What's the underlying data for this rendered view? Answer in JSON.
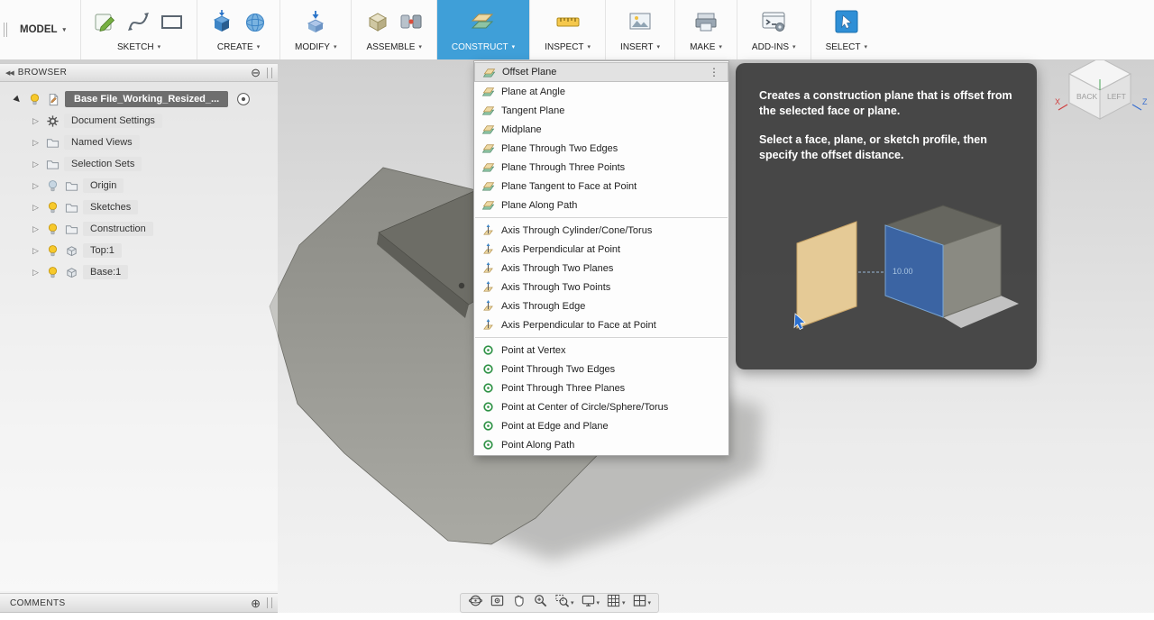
{
  "toolbar": {
    "model_label": "MODEL",
    "groups": [
      {
        "label": "SKETCH",
        "icons": [
          "sketch",
          "spline",
          "rectangle"
        ]
      },
      {
        "label": "CREATE",
        "icons": [
          "extrude",
          "sphere"
        ]
      },
      {
        "label": "MODIFY",
        "icons": [
          "press-pull"
        ]
      },
      {
        "label": "ASSEMBLE",
        "icons": [
          "new-component",
          "joint"
        ]
      },
      {
        "label": "CONSTRUCT",
        "icons": [
          "construction-plane"
        ],
        "active": true
      },
      {
        "label": "INSPECT",
        "icons": [
          "measure"
        ]
      },
      {
        "label": "INSERT",
        "icons": [
          "insert-image"
        ]
      },
      {
        "label": "MAKE",
        "icons": [
          "print-3d"
        ]
      },
      {
        "label": "ADD-INS",
        "icons": [
          "scripts-addins"
        ]
      },
      {
        "label": "SELECT",
        "icons": [
          "select"
        ]
      }
    ]
  },
  "browser": {
    "title": "BROWSER",
    "root_label": "Base File_Working_Resized_...",
    "items": [
      {
        "label": "Document Settings",
        "icon": "gear"
      },
      {
        "label": "Named Views",
        "icon": "folder"
      },
      {
        "label": "Selection Sets",
        "icon": "folder"
      },
      {
        "label": "Origin",
        "icon": "folder",
        "bulb": "off"
      },
      {
        "label": "Sketches",
        "icon": "folder",
        "bulb": "on"
      },
      {
        "label": "Construction",
        "icon": "folder",
        "bulb": "on"
      },
      {
        "label": "Top:1",
        "icon": "component",
        "bulb": "on"
      },
      {
        "label": "Base:1",
        "icon": "component",
        "bulb": "on"
      }
    ]
  },
  "construct_menu": {
    "items": [
      {
        "label": "Offset Plane",
        "icon": "offset-plane",
        "highlighted": true,
        "more": true
      },
      {
        "label": "Plane at Angle",
        "icon": "plane-at-angle"
      },
      {
        "label": "Tangent Plane",
        "icon": "tangent-plane"
      },
      {
        "label": "Midplane",
        "icon": "midplane"
      },
      {
        "label": "Plane Through Two Edges",
        "icon": "plane-two-edges"
      },
      {
        "label": "Plane Through Three Points",
        "icon": "plane-three-points"
      },
      {
        "label": "Plane Tangent to Face at Point",
        "icon": "plane-tangent-face"
      },
      {
        "label": "Plane Along Path",
        "icon": "plane-along-path",
        "divider_after": true
      },
      {
        "label": "Axis Through Cylinder/Cone/Torus",
        "icon": "axis-cylinder"
      },
      {
        "label": "Axis Perpendicular at Point",
        "icon": "axis-perpendicular-point"
      },
      {
        "label": "Axis Through Two Planes",
        "icon": "axis-two-planes"
      },
      {
        "label": "Axis Through Two Points",
        "icon": "axis-two-points"
      },
      {
        "label": "Axis Through Edge",
        "icon": "axis-edge"
      },
      {
        "label": "Axis Perpendicular to Face at Point",
        "icon": "axis-perp-face",
        "divider_after": true
      },
      {
        "label": "Point at Vertex",
        "icon": "point-vertex"
      },
      {
        "label": "Point Through Two Edges",
        "icon": "point-two-edges"
      },
      {
        "label": "Point Through Three Planes",
        "icon": "point-three-planes"
      },
      {
        "label": "Point at Center of Circle/Sphere/Torus",
        "icon": "point-center-circle"
      },
      {
        "label": "Point at Edge and Plane",
        "icon": "point-edge-plane"
      },
      {
        "label": "Point Along Path",
        "icon": "point-along-path"
      }
    ]
  },
  "tooltip": {
    "p1": "Creates a construction plane that is offset from the selected face or plane.",
    "p2": "Select a face, plane, or sketch profile, then specify the offset distance.",
    "dimension_label": "10.00"
  },
  "viewcube": {
    "faces": [
      "BACK",
      "LEFT"
    ],
    "axes": [
      "X",
      "Z"
    ]
  },
  "comments": {
    "title": "COMMENTS"
  },
  "navbar": {
    "items": [
      {
        "name": "orbit"
      },
      {
        "name": "look-at"
      },
      {
        "name": "pan"
      },
      {
        "name": "zoom"
      },
      {
        "name": "zoom-window",
        "caret": true
      },
      {
        "name": "display-settings",
        "caret": true
      },
      {
        "name": "grid-and-snaps",
        "caret": true
      },
      {
        "name": "viewports",
        "caret": true
      }
    ]
  },
  "colors": {
    "accent_blue": "#3f9fd8",
    "selection_gray": "#6e6e6e",
    "tooltip_bg": "#3c3c3c"
  }
}
